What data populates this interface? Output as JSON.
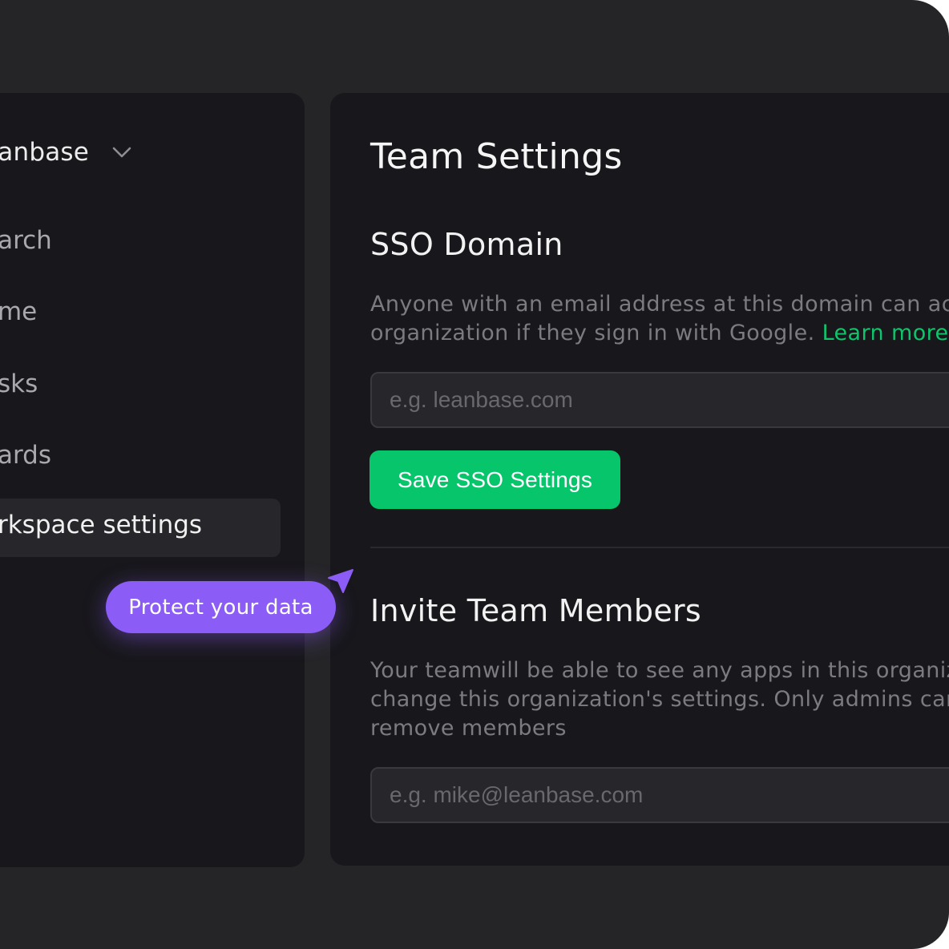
{
  "sidebar": {
    "workspace_name": "eanbase",
    "items": [
      {
        "label": "earch"
      },
      {
        "label": "ome"
      },
      {
        "label": "asks"
      },
      {
        "label": "oards"
      },
      {
        "label": "orkspace settings"
      }
    ]
  },
  "tooltip": {
    "label": "Protect your data"
  },
  "main": {
    "title": "Team Settings",
    "sso": {
      "heading": "SSO Domain",
      "desc_line1": "Anyone with an email address at this domain can ac",
      "desc_line2": "organization if they sign in with Google.",
      "learn_more": "Learn more.",
      "placeholder": "e.g. leanbase.com",
      "save_label": "Save SSO Settings"
    },
    "invite": {
      "heading": "Invite Team Members",
      "desc_line1": "Your teamwill be able to see any apps in this organiz",
      "desc_line2": "change this organization's settings. Only admins car",
      "desc_line3": "remove members",
      "placeholder": "e.g. mike@leanbase.com"
    }
  },
  "colors": {
    "accent_green": "#07c56a",
    "accent_purple": "#8b5cf6",
    "panel_bg": "#18171b",
    "frame_bg": "#252527"
  },
  "icons": {
    "workspace_chevron": "chevron-down-icon",
    "cursor": "cursor-arrow-icon"
  }
}
